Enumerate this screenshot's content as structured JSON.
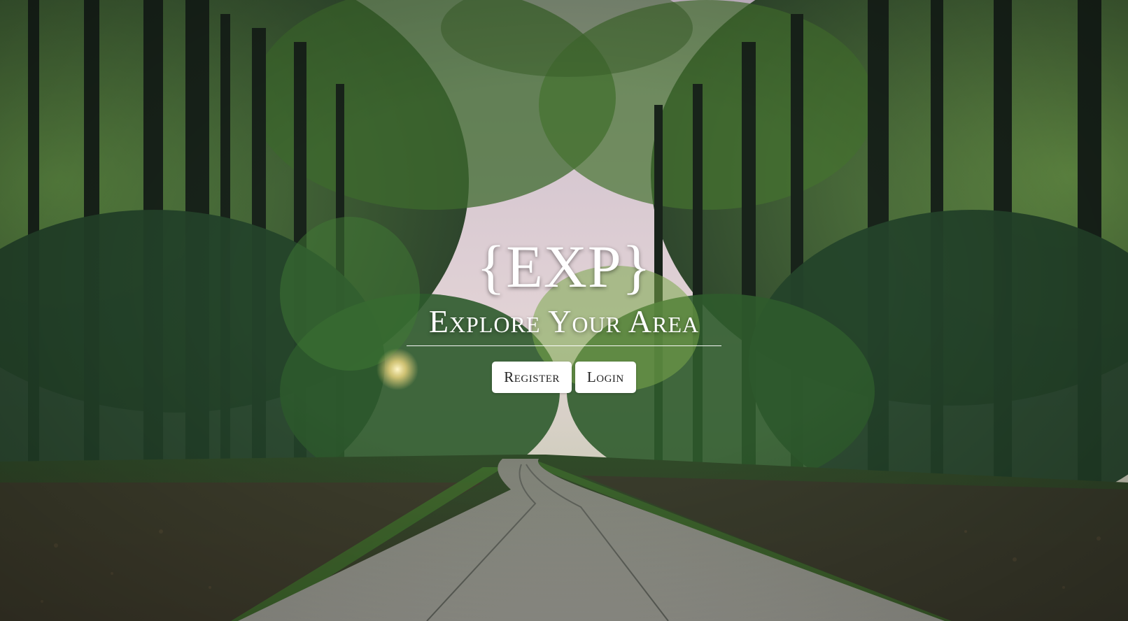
{
  "brand": {
    "logo_text": "{EXP}",
    "tagline": "Explore Your Area"
  },
  "actions": {
    "register_label": "Register",
    "login_label": "Login"
  },
  "background": {
    "description_icon": "forest-road-photo",
    "colors": {
      "sky": "#d9c7d6",
      "foliage": "#2f5a2c",
      "foliage_light": "#6a9a3c",
      "trunk": "#1a2418",
      "road": "#8d8f86",
      "grass": "#3e6b2c"
    }
  }
}
